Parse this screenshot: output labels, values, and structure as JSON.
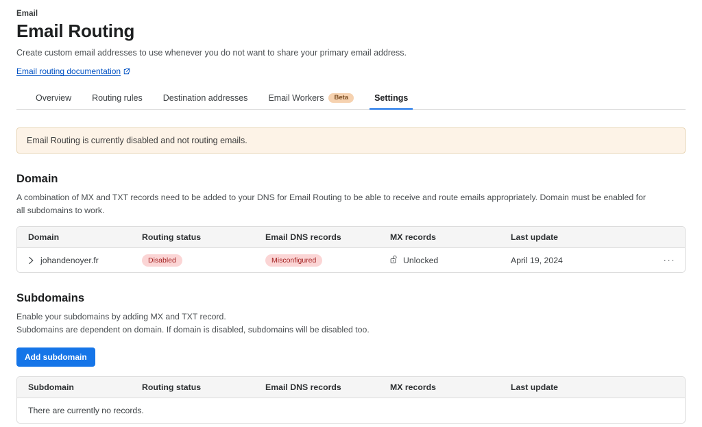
{
  "header": {
    "eyebrow": "Email",
    "title": "Email Routing",
    "description": "Create custom email addresses to use whenever you do not want to share your primary email address.",
    "doc_link": "Email routing documentation",
    "doc_link_icon": "external-link-icon"
  },
  "tabs": [
    {
      "label": "Overview",
      "active": false
    },
    {
      "label": "Routing rules",
      "active": false
    },
    {
      "label": "Destination addresses",
      "active": false
    },
    {
      "label": "Email Workers",
      "active": false,
      "badge": "Beta"
    },
    {
      "label": "Settings",
      "active": true
    }
  ],
  "alert": {
    "message": "Email Routing is currently disabled and not routing emails.",
    "background": "#fdf3e7",
    "border": "#e8d5b5"
  },
  "domain_section": {
    "title": "Domain",
    "description": "A combination of MX and TXT records need to be added to your DNS for Email Routing to be able to receive and route emails appropriately. Domain must be enabled for all subdomains to work.",
    "columns": [
      "Domain",
      "Routing status",
      "Email DNS records",
      "MX records",
      "Last update"
    ],
    "rows": [
      {
        "name": "johandenoyer.fr",
        "chevron": "chevron-right-icon",
        "routing_status": "Disabled",
        "dns_records": "Misconfigured",
        "mx_records": "Unlocked",
        "mx_icon": "unlocked-padlock-icon",
        "last_update": "April 19, 2024",
        "menu": "···"
      }
    ]
  },
  "subdomain_section": {
    "title": "Subdomains",
    "description_line1": "Enable your subdomains by adding MX and TXT record.",
    "description_line2": "Subdomains are dependent on domain. If domain is disabled, subdomains will be disabled too.",
    "add_button": "Add subdomain",
    "columns": [
      "Subdomain",
      "Routing status",
      "Email DNS records",
      "MX records",
      "Last update"
    ],
    "empty_message": "There are currently no records."
  },
  "colors": {
    "accent_blue": "#1575e8",
    "link_blue": "#0051c3",
    "badge_pink_bg": "#fbd5d5",
    "badge_pink_text": "#a32121",
    "beta_bg": "#f6d2b0",
    "beta_text": "#7a4d23"
  }
}
